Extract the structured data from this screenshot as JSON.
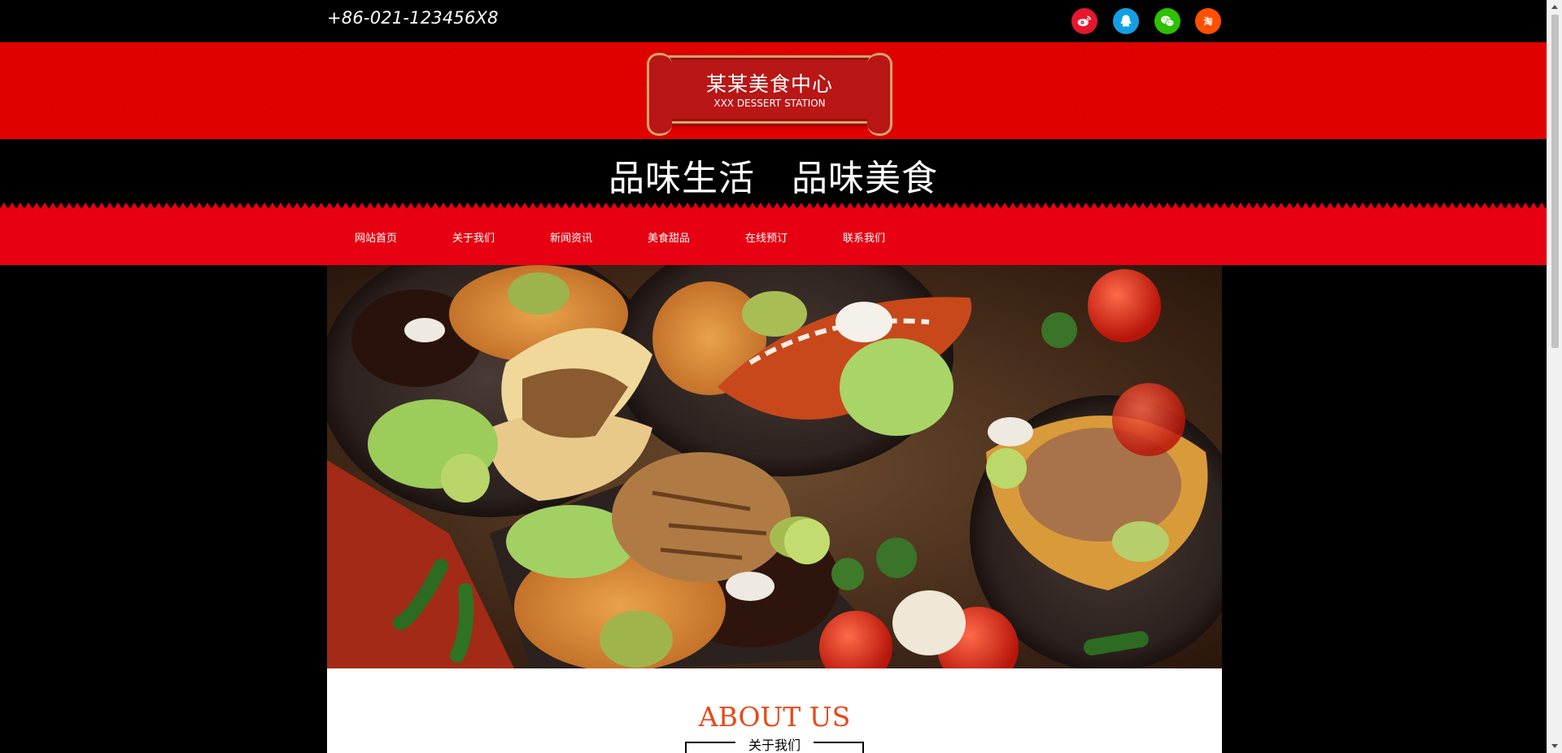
{
  "topbar": {
    "phone": "+86-021-123456X8",
    "social": [
      {
        "icon": "weibo-icon",
        "color": "#e6162d",
        "glyph": "微"
      },
      {
        "icon": "qq-icon",
        "color": "#12a0e3",
        "glyph": "Q"
      },
      {
        "icon": "wechat-icon",
        "color": "#2dc100",
        "glyph": "微"
      },
      {
        "icon": "taobao-icon",
        "color": "#ff5000",
        "glyph": "淘"
      }
    ]
  },
  "logo": {
    "title": "某某美食中心",
    "subtitle": "XXX DESSERT STATION"
  },
  "slogan": "品味生活　品味美食",
  "nav": {
    "items": [
      {
        "label": "网站首页"
      },
      {
        "label": "关于我们"
      },
      {
        "label": "新闻资讯"
      },
      {
        "label": "美食甜品"
      },
      {
        "label": "在线预订"
      },
      {
        "label": "联系我们"
      }
    ]
  },
  "about": {
    "title": "ABOUT US",
    "subtitle": "关于我们"
  },
  "colors": {
    "brand_red": "#e60012",
    "logo_red": "#b91616",
    "accent_orange": "#e64a19"
  }
}
